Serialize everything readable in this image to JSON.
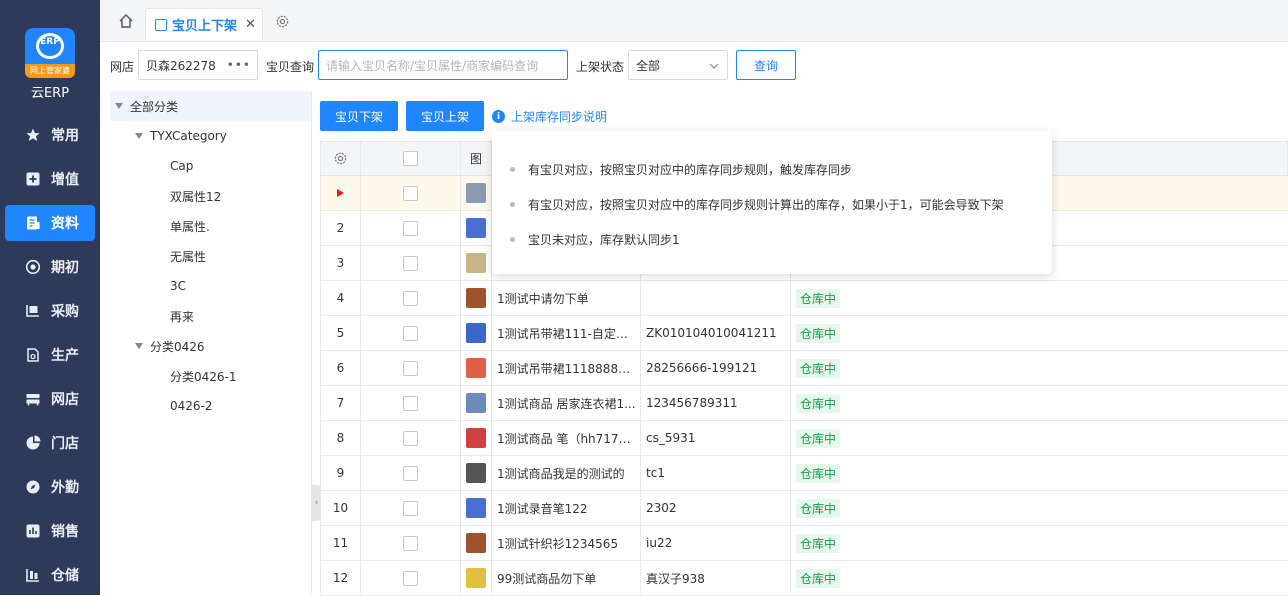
{
  "app": {
    "logo_caption": "云ERP",
    "logo_badge": "网上管家婆",
    "logo_mark": "ERP"
  },
  "nav": {
    "items": [
      {
        "label": "常用",
        "icon": "star-icon"
      },
      {
        "label": "增值",
        "icon": "plus-square-icon"
      },
      {
        "label": "资料",
        "icon": "document-icon",
        "active": true
      },
      {
        "label": "期初",
        "icon": "target-icon"
      },
      {
        "label": "采购",
        "icon": "cart-icon"
      },
      {
        "label": "生产",
        "icon": "factory-icon"
      },
      {
        "label": "网店",
        "icon": "store-icon"
      },
      {
        "label": "门店",
        "icon": "pie-icon"
      },
      {
        "label": "外勤",
        "icon": "compass-icon"
      },
      {
        "label": "销售",
        "icon": "bar-chart-icon"
      },
      {
        "label": "仓储",
        "icon": "warehouse-icon"
      }
    ]
  },
  "tabs": {
    "active_label": "宝贝上下架",
    "close_glyph": "✕"
  },
  "filters": {
    "shop_label": "网店",
    "shop_value": "贝森262278",
    "shop_more": "•••",
    "query_label": "宝贝查询",
    "query_placeholder": "请输入宝贝名称/宝贝属性/商家编码查询",
    "status_label": "上架状态",
    "status_value": "全部",
    "search_button": "查询"
  },
  "tree": {
    "root": "全部分类",
    "groups": [
      {
        "label": "TYXCategory",
        "children": [
          "Cap",
          "双属性12",
          "单属性.",
          "无属性",
          "3C",
          "再来"
        ]
      },
      {
        "label": "分类0426",
        "children": [
          "分类0426-1",
          "0426-2"
        ]
      }
    ]
  },
  "actions": {
    "off_shelf": "宝贝下架",
    "on_shelf": "宝贝上架",
    "info_link": "上架库存同步说明"
  },
  "popover": {
    "lines": [
      "有宝贝对应，按照宝贝对应中的库存同步规则，触发库存同步",
      "有宝贝对应，按照宝贝对应中的库存同步规则计算出的库存，如果小于1，可能会导致下架",
      "宝贝未对应，库存默认同步1"
    ]
  },
  "table": {
    "header_img": "图",
    "current_marker": "▶",
    "rows": [
      {
        "num": "",
        "name": "",
        "code": "",
        "status": "",
        "thumb": "#8a9bb0"
      },
      {
        "num": "2",
        "name": "",
        "code": "",
        "status": "",
        "thumb": "#4a6fd0"
      },
      {
        "num": "3",
        "name": "",
        "code": "",
        "status": "",
        "thumb": "#c9b48a"
      },
      {
        "num": "4",
        "name": "1测试中请勿下单",
        "code": "",
        "status": "仓库中",
        "thumb": "#a0522d"
      },
      {
        "num": "5",
        "name": "1测试吊带裙111-自定义...",
        "code": "ZK010104010041211",
        "status": "仓库中",
        "thumb": "#3a66c9"
      },
      {
        "num": "6",
        "name": "1测试吊带裙11188888...",
        "code": "28256666-199121",
        "status": "仓库中",
        "thumb": "#e0604a"
      },
      {
        "num": "7",
        "name": "1测试商品 居家连衣裙1...",
        "code": "123456789311",
        "status": "仓库中",
        "thumb": "#6d8bb8"
      },
      {
        "num": "8",
        "name": "1测试商品 笔（hh7170...",
        "code": "cs_5931",
        "status": "仓库中",
        "thumb": "#d04040"
      },
      {
        "num": "9",
        "name": "1测试商品我是的测试的",
        "code": "tc1",
        "status": "仓库中",
        "thumb": "#555555"
      },
      {
        "num": "10",
        "name": "1测试录音笔122",
        "code": "2302",
        "status": "仓库中",
        "thumb": "#4a6fd0"
      },
      {
        "num": "11",
        "name": "1测试针织衫1234565",
        "code": "iu22",
        "status": "仓库中",
        "thumb": "#a0522d"
      },
      {
        "num": "12",
        "name": "99测试商品勿下单",
        "code": "真汉子938",
        "status": "仓库中",
        "thumb": "#e0c040"
      }
    ]
  },
  "colors": {
    "primary": "#1f86ff",
    "nav_bg": "#2e3a59",
    "status_tag": "#1a9a4a"
  }
}
